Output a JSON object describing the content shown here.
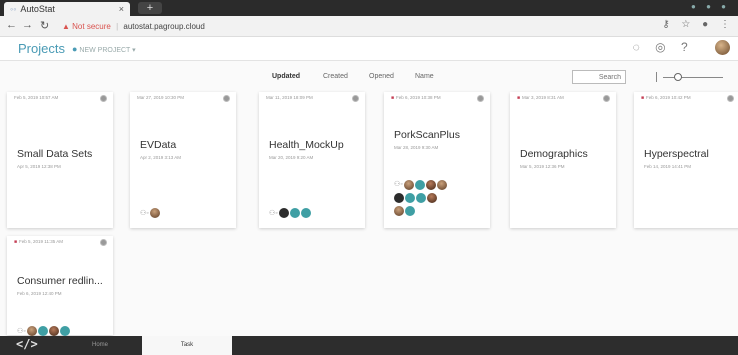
{
  "browser": {
    "tab_title": "AutoStat",
    "tab_close": "×",
    "new_tab": "+",
    "not_secure": "Not secure",
    "url": "autostat.pagroup.cloud"
  },
  "app": {
    "title": "Projects",
    "new_project": "NEW PROJECT",
    "colors": {
      "accent": "#4a9bb5",
      "lock": "#c43f55",
      "avatar_teal": "#3f9fa4",
      "nav_bg": "#2d2d2d"
    }
  },
  "sort": {
    "options": [
      "Updated",
      "Created",
      "Opened",
      "Name"
    ],
    "active": "Updated",
    "search_placeholder": "Search",
    "zoom_level": 0.2
  },
  "projects": [
    {
      "date": "Feb 5, 2019 10:57 AM",
      "title": "Small Data Sets",
      "sub": "Apr 5, 2019 12:38 PM",
      "locked": false,
      "members": []
    },
    {
      "date": "Mar 27, 2019 10:30 PM",
      "title": "EVData",
      "sub": "Apr 2, 2019 3:13 AM",
      "locked": false,
      "members": [
        "photo"
      ]
    },
    {
      "date": "Mar 11, 2019 18:09 PM",
      "title": "Health_MockUp",
      "sub": "Mar 20, 2019 9:20 AM",
      "locked": false,
      "members": [
        "dark",
        "teal",
        "teal"
      ]
    },
    {
      "date": "Feb 6, 2019 10:38 PM",
      "title": "PorkScanPlus",
      "sub": "Mar 28, 2019 9:30 AM",
      "locked": true,
      "members": [
        "photo",
        "teal",
        "photo2",
        "photo",
        "dark",
        "teal",
        "teal",
        "photo2",
        "photo",
        "teal"
      ]
    },
    {
      "date": "Mar 3, 2019 8:31 AM",
      "title": "Demographics",
      "sub": "Mar 5, 2019 12:36 PM",
      "locked": true,
      "members": []
    },
    {
      "date": "Feb 6, 2019 10:42 PM",
      "title": "Hyperspectral",
      "sub": "Feb 14, 2019 14:41 PM",
      "locked": true,
      "members": []
    },
    {
      "date": "Feb 5, 2019 11:35 AM",
      "title": "Consumer redlin...",
      "sub": "Feb 6, 2019 12:40 PM",
      "locked": true,
      "members": [
        "photo",
        "teal",
        "photo2",
        "teal"
      ]
    }
  ],
  "bottom_nav": {
    "logo": "</>",
    "tabs": [
      "Home",
      "Task"
    ],
    "active": "Task"
  }
}
